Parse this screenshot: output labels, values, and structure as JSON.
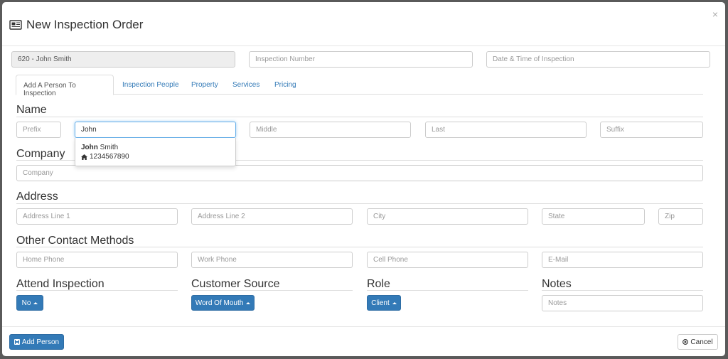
{
  "modal": {
    "title": "New Inspection Order",
    "close_glyph": "×"
  },
  "header_fields": {
    "client_value": "620 - John Smith",
    "inspection_number_placeholder": "Inspection Number",
    "datetime_placeholder": "Date & Time of Inspection"
  },
  "tabs": [
    {
      "label": "Add A Person To Inspection",
      "active": true
    },
    {
      "label": "Inspection People",
      "active": false
    },
    {
      "label": "Property",
      "active": false
    },
    {
      "label": "Services",
      "active": false
    },
    {
      "label": "Pricing",
      "active": false
    }
  ],
  "name_section": {
    "title": "Name",
    "prefix_placeholder": "Prefix",
    "first_value": "John",
    "middle_placeholder": "Middle",
    "last_placeholder": "Last",
    "suffix_placeholder": "Suffix"
  },
  "autocomplete": {
    "first_bold": "John",
    "rest": " Smith",
    "phone": "1234567890",
    "phone_icon": "home-icon"
  },
  "company_section": {
    "title": "Company",
    "company_placeholder": "Company"
  },
  "address_section": {
    "title": "Address",
    "line1_placeholder": "Address Line 1",
    "line2_placeholder": "Address Line 2",
    "city_placeholder": "City",
    "state_placeholder": "State",
    "zip_placeholder": "Zip"
  },
  "contact_section": {
    "title": "Other Contact Methods",
    "home_placeholder": "Home Phone",
    "work_placeholder": "Work Phone",
    "cell_placeholder": "Cell Phone",
    "email_placeholder": "E-Mail"
  },
  "attend": {
    "title": "Attend Inspection",
    "value": "No"
  },
  "source": {
    "title": "Customer Source",
    "value": "Word Of Mouth"
  },
  "role": {
    "title": "Role",
    "value": "Client"
  },
  "notes": {
    "title": "Notes",
    "placeholder": "Notes"
  },
  "footer": {
    "add_label": "Add Person",
    "cancel_label": "Cancel"
  },
  "colors": {
    "primary": "#337ab7",
    "border": "#cccccc",
    "backdrop": "#5a5a5a"
  }
}
